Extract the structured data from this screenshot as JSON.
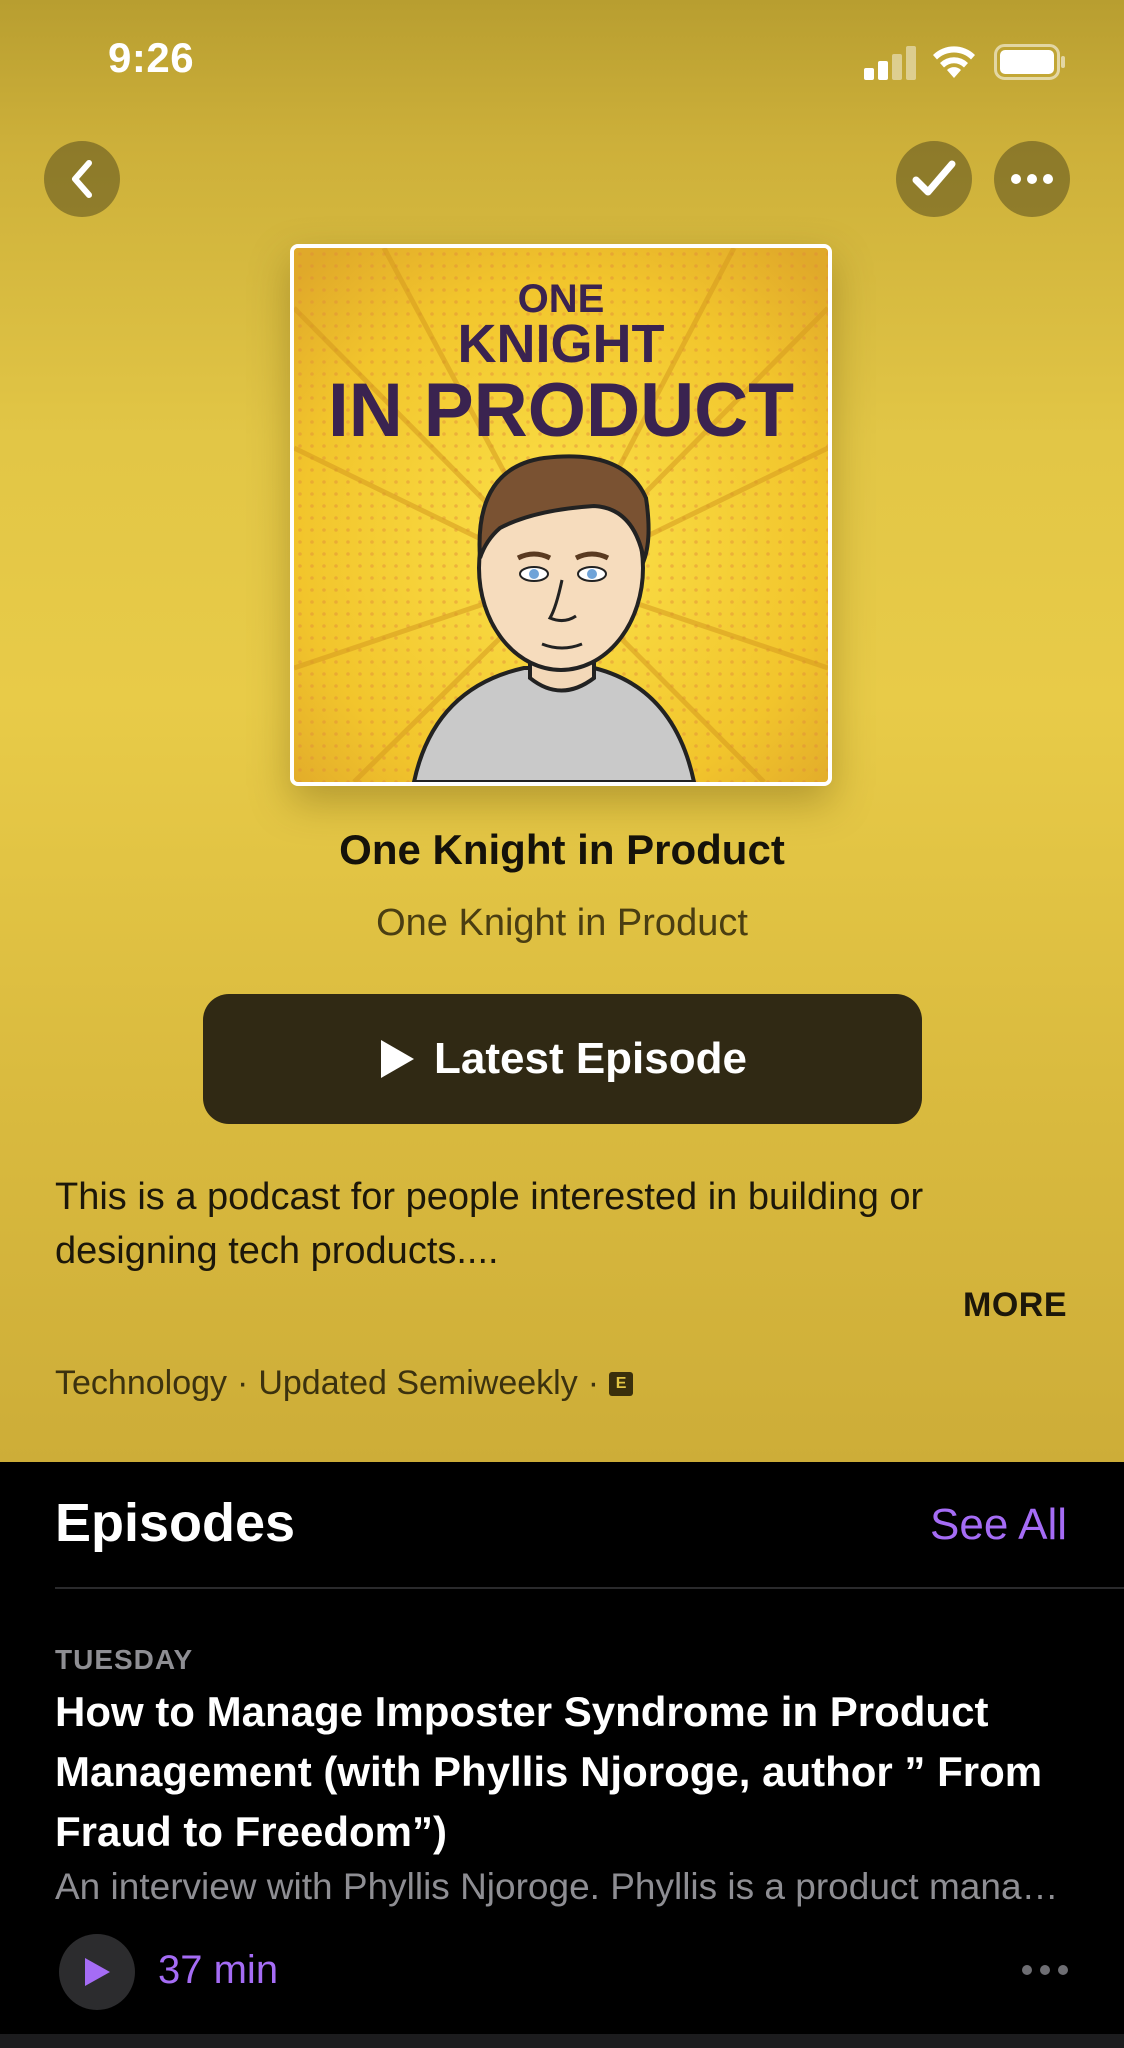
{
  "status_bar": {
    "time": "9:26"
  },
  "header": {
    "back_icon": "chevron-left-icon",
    "subscribed_icon": "checkmark-icon",
    "more_icon": "ellipsis-icon"
  },
  "podcast": {
    "artwork_text": [
      "ONE",
      "KNIGHT",
      "IN PRODUCT"
    ],
    "title": "One Knight in Product",
    "author": "One Knight in Product",
    "play_button_label": "Latest Episode",
    "description": "This is a podcast for people interested in building or designing tech products....",
    "more_label": "MORE",
    "category": "Technology",
    "update_frequency": "Updated Semiweekly",
    "separator": "·",
    "explicit_badge": "E"
  },
  "episodes": {
    "heading": "Episodes",
    "see_all_label": "See All",
    "items": [
      {
        "date": "TUESDAY",
        "title": "How to Manage Imposter Syndrome in Product Management (with Phyllis Njoroge, author ” From Fraud to Freedom”)",
        "summary": "An interview with Phyllis Njoroge. Phyllis is a product manager and author of From Fraud to Freedom.",
        "duration": "37 min"
      }
    ]
  },
  "colors": {
    "accent_purple": "#a56cf5",
    "header_yellow": "#e2c646",
    "button_dark": "#302914",
    "background": "#000000"
  }
}
